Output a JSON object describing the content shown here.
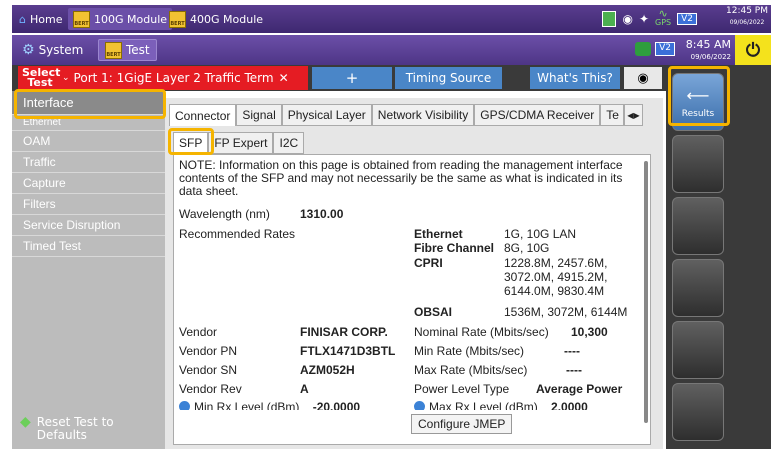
{
  "os_bar": {
    "tabs": [
      {
        "label": "Home",
        "icon": "home-icon"
      },
      {
        "label": "100G Module",
        "icon": "bert-module-icon"
      },
      {
        "label": "400G Module",
        "icon": "bert-module-icon"
      }
    ],
    "bert_tag": "BERT",
    "gps_label": "GPS",
    "v2_label": "V2",
    "time": "12:45 PM",
    "date": "09/06/2022"
  },
  "app_bar": {
    "system_label": "System",
    "test_label": "Test",
    "time": "8:45 AM",
    "date": "09/06/2022",
    "v2_label": "V2"
  },
  "tab_strip": {
    "select_test": "Select Test",
    "active_test": "Port 1: 1GigE Layer 2 Traffic Term",
    "add_tab": "+",
    "timing_source": "Timing Source",
    "whats_this": "What's This?"
  },
  "sidebar": {
    "items": [
      "Interface",
      "Ethernet",
      "OAM",
      "Traffic",
      "Capture",
      "Filters",
      "Service Disruption",
      "Timed Test"
    ],
    "reset_label": "Reset Test to Defaults"
  },
  "tabs_top": [
    "Connector",
    "Signal",
    "Physical Layer",
    "Network Visibility",
    "GPS/CDMA Receiver",
    "Te"
  ],
  "tabs_sub": [
    "SFP",
    "FP Expert",
    "I2C"
  ],
  "sfp": {
    "note": "NOTE: Information on this page is obtained from reading the management interface contents of the SFP and may not necessarily be the same as what is indicated in its data sheet.",
    "wavelength_label": "Wavelength (nm)",
    "wavelength_value": "1310.00",
    "recommended_label": "Recommended Rates",
    "rates": [
      {
        "name": "Ethernet",
        "value": "1G, 10G LAN"
      },
      {
        "name": "Fibre Channel",
        "value": "8G, 10G"
      },
      {
        "name": "CPRI",
        "value": "1228.8M, 2457.6M, 3072.0M, 4915.2M, 6144.0M, 9830.4M"
      },
      {
        "name": "OBSAI",
        "value": "1536M, 3072M, 6144M"
      }
    ],
    "vendor_label": "Vendor",
    "vendor_value": "FINISAR CORP.",
    "vendor_pn_label": "Vendor PN",
    "vendor_pn_value": "FTLX1471D3BTL",
    "vendor_sn_label": "Vendor SN",
    "vendor_sn_value": "AZM052H",
    "vendor_rev_label": "Vendor Rev",
    "vendor_rev_value": "A",
    "nominal_rate_label": "Nominal Rate (Mbits/sec)",
    "nominal_rate_value": "10,300",
    "min_rate_label": "Min Rate (Mbits/sec)",
    "min_rate_value": "----",
    "max_rate_label": "Max Rate (Mbits/sec)",
    "max_rate_value": "----",
    "power_type_label": "Power Level Type",
    "power_type_value": "Average Power",
    "min_rx_label": "Min Rx Level (dBm)",
    "min_rx_value": "-20.0000",
    "max_rx_label": "Max Rx Level (dBm)",
    "max_rx_value": "2.0000",
    "configure_jmep": "Configure JMEP"
  },
  "right_panel": {
    "results_label": "Results"
  },
  "colors": {
    "accent": "#5a3d8f",
    "select_tab": "#e51c23",
    "highlight": "#f5b400",
    "power": "#f4e21c"
  }
}
